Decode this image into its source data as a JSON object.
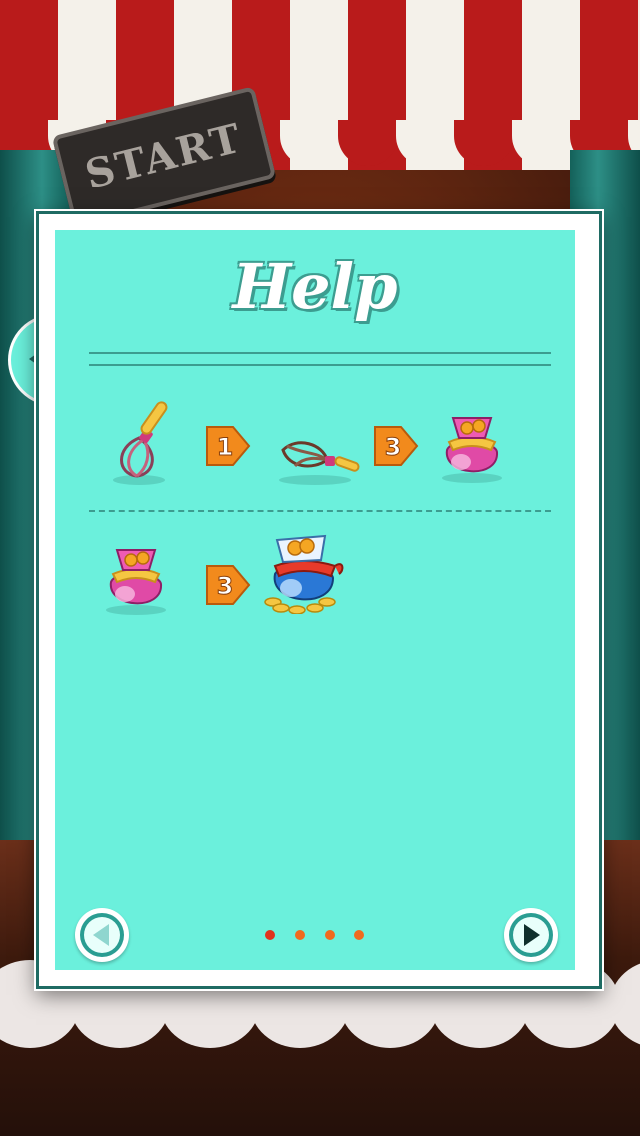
{
  "background": {
    "sign_text": "START"
  },
  "help": {
    "title": "Help",
    "rows": [
      {
        "items": [
          {
            "icon": "whisk-icon"
          },
          {
            "arrow_count": "1"
          },
          {
            "icon": "broken-whisk-icon"
          },
          {
            "arrow_count": "3"
          },
          {
            "icon": "pink-coin-bag-icon"
          }
        ]
      },
      {
        "items": [
          {
            "icon": "pink-coin-bag-icon"
          },
          {
            "arrow_count": "3"
          },
          {
            "icon": "blue-coin-bag-icon"
          }
        ]
      }
    ],
    "pagination": {
      "total": 4,
      "current": 1
    }
  },
  "colors": {
    "panel_bg": "#6bf0dc",
    "accent": "#3c9d90",
    "arrow": "#f28a1c",
    "dot": "#f06a1e"
  }
}
